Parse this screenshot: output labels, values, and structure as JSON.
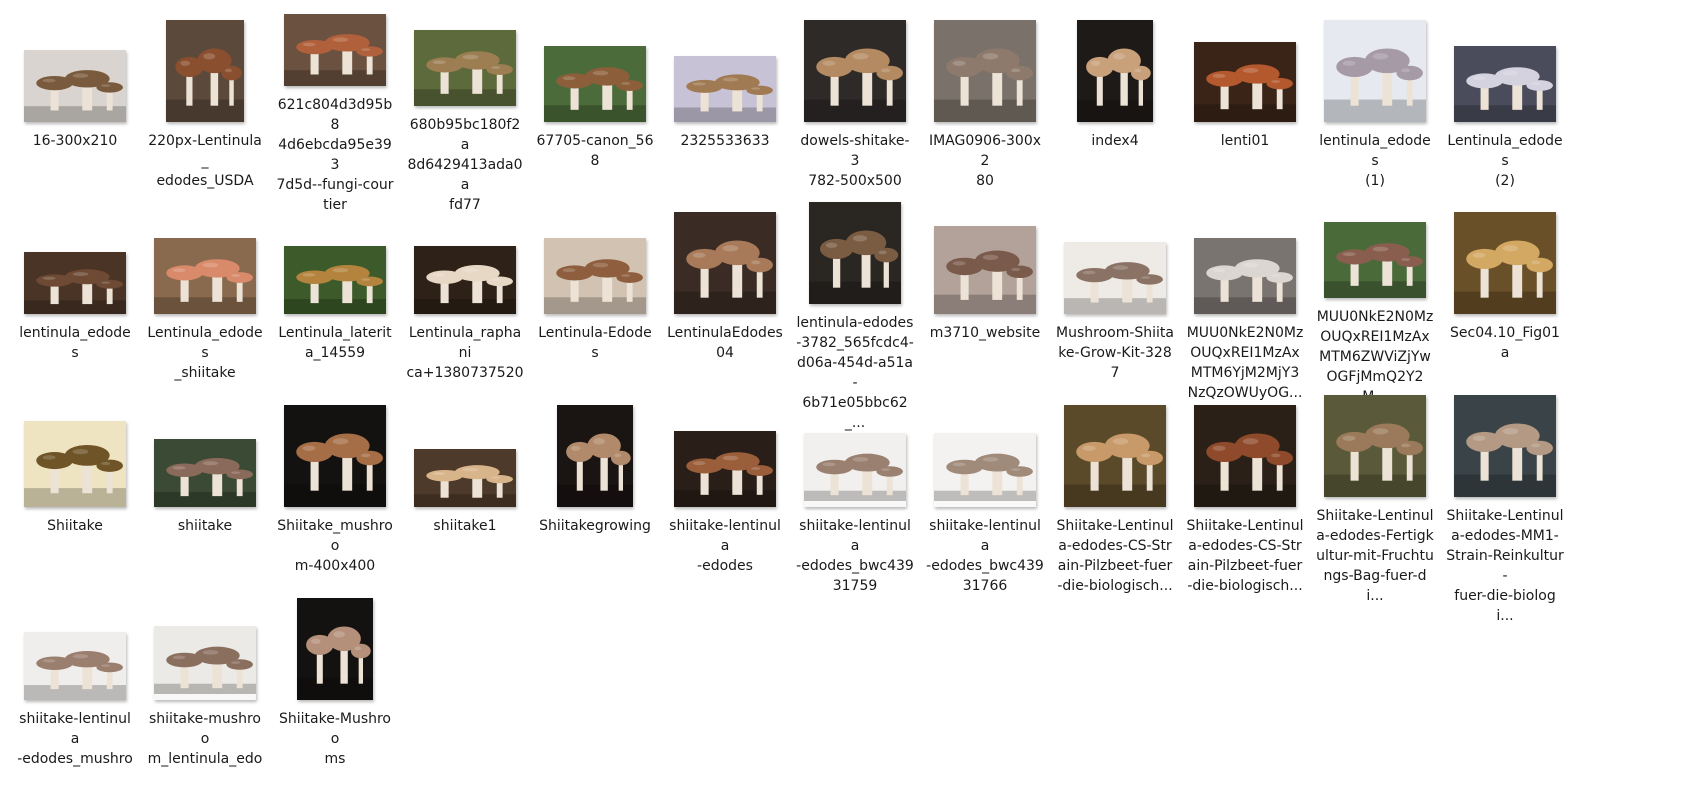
{
  "view": "Large icons",
  "files": [
    {
      "name": "16-300x210",
      "bg": "#d9d4cf",
      "cap": "#7a5a3c"
    },
    {
      "name": "220px-Lentinula_\nedodes_USDA",
      "bg": "#5b4a3b",
      "cap": "#8a4f2e"
    },
    {
      "name": "621c804d3d95b8\n4d6ebcda95e393\n7d5d--fungi-cour\ntier",
      "bg": "#6b5140",
      "cap": "#b0603a"
    },
    {
      "name": "680b95bc180f2a\n8d6429413ada0a\nfd77",
      "bg": "#5d6a3c",
      "cap": "#9c7e52"
    },
    {
      "name": "67705-canon_568",
      "bg": "#4c6b3a",
      "cap": "#8c5e3a"
    },
    {
      "name": "2325533633",
      "bg": "#c7c2d6",
      "cap": "#a07a52"
    },
    {
      "name": "dowels-shitake-3\n782-500x500",
      "bg": "#2e2a28",
      "cap": "#b48a62"
    },
    {
      "name": "IMAG0906-300x2\n80",
      "bg": "#7a726a",
      "cap": "#8e7a6c"
    },
    {
      "name": "index4",
      "bg": "#1e1a18",
      "cap": "#c8a07a"
    },
    {
      "name": "lenti01",
      "bg": "#3a2418",
      "cap": "#b4582e"
    },
    {
      "name": "lentinula_edodes\n(1)",
      "bg": "#e6e9ef",
      "cap": "#a69aa6"
    },
    {
      "name": "Lentinula_edodes\n(2)",
      "bg": "#4a4c5c",
      "cap": "#d4d2de"
    },
    {
      "name": "lentinula_edodes",
      "bg": "#4a3426",
      "cap": "#6e4a34"
    },
    {
      "name": "Lentinula_edodes\n_shiitake",
      "bg": "#8a6a4e",
      "cap": "#d88a6a"
    },
    {
      "name": "Lentinula_laterit\na_14559",
      "bg": "#3c5a2a",
      "cap": "#b4843e"
    },
    {
      "name": "Lentinula_raphani\nca+1380737520",
      "bg": "#2e2218",
      "cap": "#e6d8c4"
    },
    {
      "name": "Lentinula-Edodes",
      "bg": "#d2c2b2",
      "cap": "#8e5e3e"
    },
    {
      "name": "LentinulaEdodes\n04",
      "bg": "#3a2c24",
      "cap": "#a87a5a"
    },
    {
      "name": "lentinula-edodes\n-3782_565fcdc4-\nd06a-454d-a51a-\n6b71e05bbc62_...",
      "bg": "#2a2622",
      "cap": "#7a5c42"
    },
    {
      "name": "m3710_website",
      "bg": "#b2a29a",
      "cap": "#7a5a4a"
    },
    {
      "name": "Mushroom-Shiita\nke-Grow-Kit-328\n7",
      "bg": "#eeeae6",
      "cap": "#8a7264"
    },
    {
      "name": "MUU0NkE2N0Mz\nOUQxREI1MzAx\nMTM6YjM2MjY3\nNzQzOWUyOG...",
      "bg": "#7a7470",
      "cap": "#dcd6d2"
    },
    {
      "name": "MUU0NkE2N0Mz\nOUQxREI1MzAx\nMTM6ZWViZjYw\nOGFjMmQ2Y2M...",
      "bg": "#4a6a3a",
      "cap": "#8a5e4e"
    },
    {
      "name": "Sec04.10_Fig01a",
      "bg": "#6a5028",
      "cap": "#d2a862"
    },
    {
      "name": "Shiitake",
      "bg": "#efe4c2",
      "cap": "#6e5426"
    },
    {
      "name": "shiitake",
      "bg": "#3a4a34",
      "cap": "#8a6a5a"
    },
    {
      "name": "Shiitake_mushroo\nm-400x400",
      "bg": "#141210",
      "cap": "#a66e46"
    },
    {
      "name": "shiitake1",
      "bg": "#4e3a2a",
      "cap": "#d8b48a"
    },
    {
      "name": "Shiitakegrowing",
      "bg": "#1a1412",
      "cap": "#b08a6a"
    },
    {
      "name": "shiitake-lentinula\n-edodes",
      "bg": "#2a1e18",
      "cap": "#9a5e3a"
    },
    {
      "name": "shiitake-lentinula\n-edodes_bwc439\n31759",
      "bg": "#f2f0ee",
      "cap": "#9a8070"
    },
    {
      "name": "shiitake-lentinula\n-edodes_bwc439\n31766",
      "bg": "#f4f2f0",
      "cap": "#a08a7a"
    },
    {
      "name": "Shiitake-Lentinul\na-edodes-CS-Str\nain-Pilzbeet-fuer\n-die-biologisch...",
      "bg": "#5a4a2a",
      "cap": "#c89a6a"
    },
    {
      "name": "Shiitake-Lentinul\na-edodes-CS-Str\nain-Pilzbeet-fuer\n-die-biologisch...",
      "bg": "#2a2018",
      "cap": "#8e4a2a"
    },
    {
      "name": "Shiitake-Lentinul\na-edodes-Fertigk\nultur-mit-Fruchtu\nngs-Bag-fuer-di...",
      "bg": "#5a5a3a",
      "cap": "#9a7a5a"
    },
    {
      "name": "Shiitake-Lentinul\na-edodes-MM1-\nStrain-Reinkultur-\nfuer-die-biologi...",
      "bg": "#3a4448",
      "cap": "#b49a84"
    },
    {
      "name": "shiitake-lentinula\n-edodes_mushro",
      "bg": "#f0eeec",
      "cap": "#9a7e6e"
    },
    {
      "name": "shiitake-mushroo\nm_lentinula_edo",
      "bg": "#eceae6",
      "cap": "#8a6e5e"
    },
    {
      "name": "Shiitake-Mushroo\nms",
      "bg": "#141210",
      "cap": "#b4907a"
    }
  ]
}
